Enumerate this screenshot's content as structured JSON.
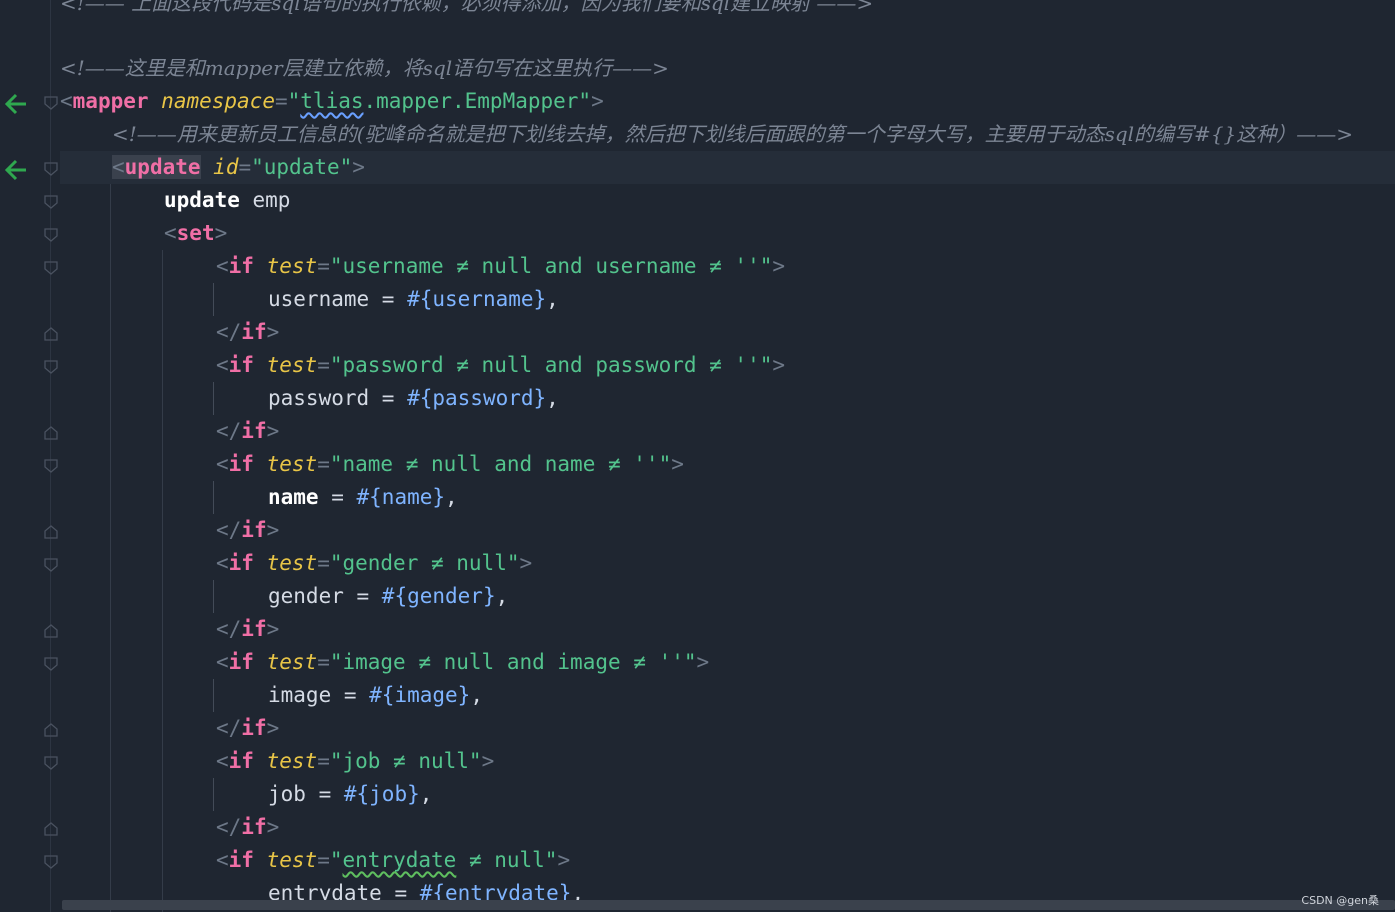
{
  "lines": {
    "l0_comment": "<!—— 上面这段代码是sql语句的执行依赖，必须得添加，因为我们要和sql建立映射 ——>",
    "l1_comment": "<!——这里是和mapper层建立依赖，将sql语句写在这里执行——>",
    "mapper": {
      "tag": "mapper",
      "attr": "namespace",
      "value_pre": "\"",
      "value_squig": "tlias",
      "value_post": ".mapper.EmpMapper\""
    },
    "l3_comment": "<!——用来更新员工信息的(驼峰命名就是把下划线去掉，然后把下划线后面跟的第一个字母大写，主要用于动态sql的编写#{}这种）——>",
    "update_tag": {
      "tag": "update",
      "attr": "id",
      "value": "\"update\""
    },
    "update_kw": "update",
    "update_table": " emp",
    "set_tag": "set",
    "if_kw": "if",
    "test_attr": "test",
    "conditions": [
      "\"username ≠ null and username ≠ ''\"",
      "\"password ≠ null and password ≠ ''\"",
      "\"name ≠ null and name ≠ ''\"",
      "\"gender ≠ null\"",
      "\"image ≠ null and image ≠ ''\"",
      "\"job ≠ null\"",
      "\"entrydate ≠ null\""
    ],
    "entry_cond_pre": "\"",
    "entry_cond_squig": "entrydate",
    "entry_cond_post": " ≠ null\"",
    "assignments": [
      {
        "field": "username",
        "eq": " = ",
        "param": "#{username}",
        "tail": ","
      },
      {
        "field": "password",
        "eq": " = ",
        "param": "#{password}",
        "tail": ","
      },
      {
        "field": "name",
        "eq": " = ",
        "param": "#{name}",
        "tail": ","
      },
      {
        "field": "gender",
        "eq": " = ",
        "param": "#{gender}",
        "tail": ","
      },
      {
        "field": "image",
        "eq": " = ",
        "param": "#{image}",
        "tail": ","
      },
      {
        "field": "job",
        "eq": " = ",
        "param": "#{job}",
        "tail": ","
      },
      {
        "field": "entrydate",
        "eq": " = ",
        "param": "#{entrydate}",
        "tail": ","
      }
    ]
  },
  "watermark": "CSDN @gen桑",
  "colors": {
    "background": "#1f2631",
    "tag": "#f06fa6",
    "attribute": "#e8c547",
    "string": "#53c38d",
    "parameter": "#7fb4ff",
    "comment": "#7c8594",
    "arrow": "#2fa84f"
  }
}
